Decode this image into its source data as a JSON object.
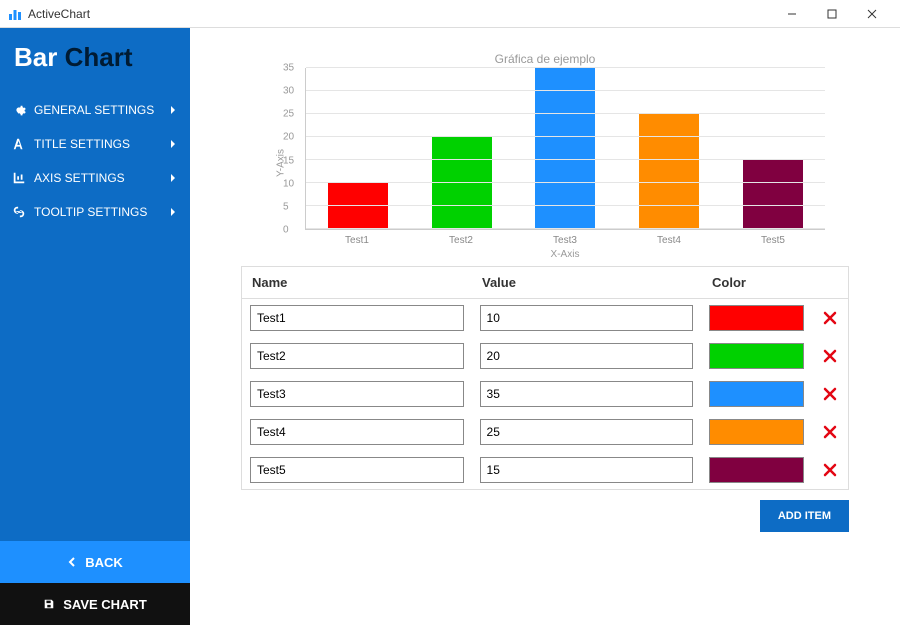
{
  "window": {
    "title": "ActiveChart"
  },
  "sidebar": {
    "page_title_a": "Bar",
    "page_title_b": "Chart",
    "items": [
      {
        "label": "GENERAL SETTINGS"
      },
      {
        "label": "TITLE SETTINGS"
      },
      {
        "label": "AXIS SETTINGS"
      },
      {
        "label": "TOOLTIP SETTINGS"
      }
    ],
    "back_label": "BACK",
    "save_label": "SAVE CHART"
  },
  "chart_data": {
    "type": "bar",
    "title": "Gráfica de ejemplo",
    "xlabel": "X-Axis",
    "ylabel": "Y-Axis",
    "ylim": [
      0,
      35
    ],
    "yticks": [
      0,
      5,
      10,
      15,
      20,
      25,
      30,
      35
    ],
    "categories": [
      "Test1",
      "Test2",
      "Test3",
      "Test4",
      "Test5"
    ],
    "values": [
      10,
      20,
      35,
      25,
      15
    ],
    "colors": [
      "#ff0000",
      "#00d100",
      "#1e90ff",
      "#ff8c00",
      "#800040"
    ]
  },
  "table": {
    "headers": {
      "name": "Name",
      "value": "Value",
      "color": "Color"
    },
    "rows": [
      {
        "name": "Test1",
        "value": "10",
        "color": "#ff0000"
      },
      {
        "name": "Test2",
        "value": "20",
        "color": "#00d100"
      },
      {
        "name": "Test3",
        "value": "35",
        "color": "#1e90ff"
      },
      {
        "name": "Test4",
        "value": "25",
        "color": "#ff8c00"
      },
      {
        "name": "Test5",
        "value": "15",
        "color": "#800040"
      }
    ],
    "add_label": "ADD ITEM"
  }
}
